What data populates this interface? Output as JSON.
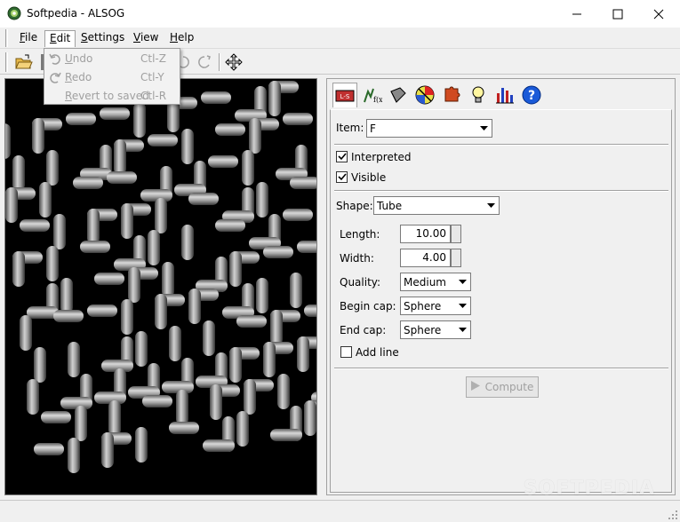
{
  "window": {
    "title": "Softpedia - ALSOG"
  },
  "menubar": {
    "items": [
      {
        "label": "File",
        "accel": "F"
      },
      {
        "label": "Edit",
        "accel": "E"
      },
      {
        "label": "Settings",
        "accel": "S"
      },
      {
        "label": "View",
        "accel": "V"
      },
      {
        "label": "Help",
        "accel": "H"
      }
    ]
  },
  "edit_menu": {
    "items": [
      {
        "label": "Undo",
        "shortcut": "Ctl-Z",
        "enabled": false
      },
      {
        "label": "Redo",
        "shortcut": "Ctl-Y",
        "enabled": false
      },
      {
        "label": "Revert to saved",
        "shortcut": "Ctl-R",
        "enabled": false
      }
    ]
  },
  "panel": {
    "tabs": [
      "lsystem-tab",
      "function-tab",
      "shape-tab",
      "color-tab",
      "puzzle-tab",
      "light-tab",
      "stats-tab",
      "help-tab"
    ],
    "item_label": "Item:",
    "item_value": "F",
    "interpreted_label": "Interpreted",
    "interpreted_checked": true,
    "visible_label": "Visible",
    "visible_checked": true,
    "shape_label": "Shape:",
    "shape_value": "Tube",
    "length_label": "Length:",
    "length_value": "10.00",
    "width_label": "Width:",
    "width_value": "4.00",
    "quality_label": "Quality:",
    "quality_value": "Medium",
    "begin_cap_label": "Begin cap:",
    "begin_cap_value": "Sphere",
    "end_cap_label": "End cap:",
    "end_cap_value": "Sphere",
    "add_line_label": "Add line",
    "add_line_checked": false,
    "compute_label": "Compute"
  },
  "watermark": "SOFTPEDIA"
}
